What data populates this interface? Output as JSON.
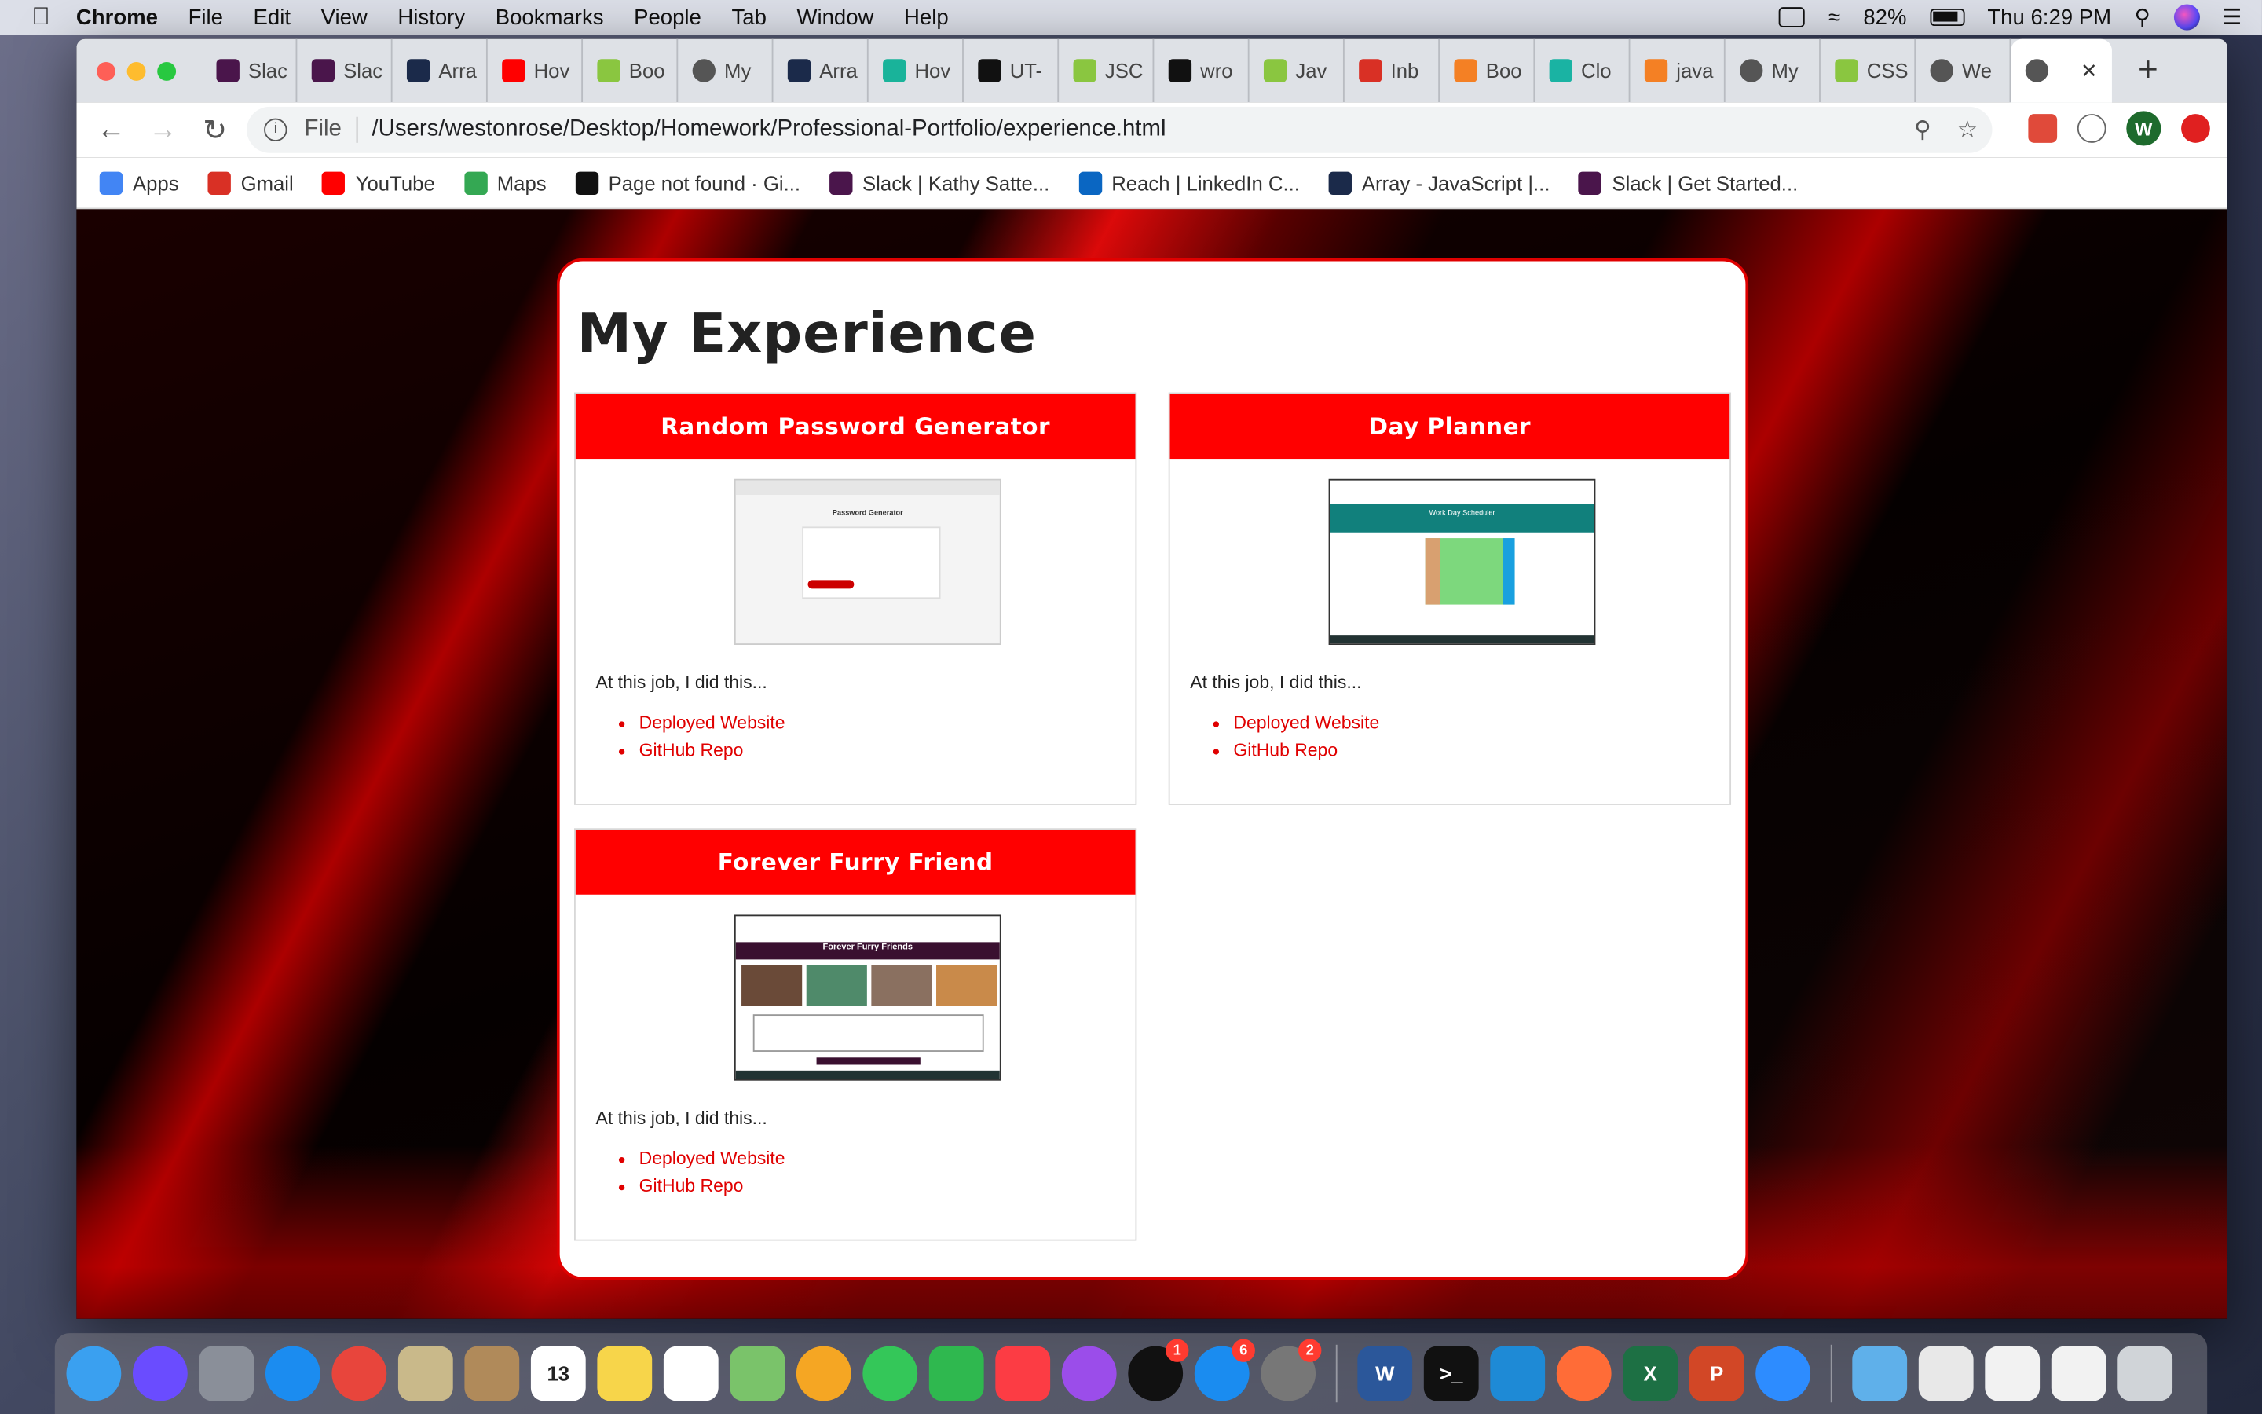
{
  "menubar": {
    "app": "Chrome",
    "items": [
      "File",
      "Edit",
      "View",
      "History",
      "Bookmarks",
      "People",
      "Tab",
      "Window",
      "Help"
    ],
    "battery": "82%",
    "clock": "Thu 6:29 PM"
  },
  "tabs": [
    {
      "label": "Slac",
      "icon": "slack-icon",
      "color": "#4a154b"
    },
    {
      "label": "Slac",
      "icon": "slack-icon",
      "color": "#4a154b"
    },
    {
      "label": "Arra",
      "icon": "mdn-icon",
      "color": "#1b2a4a"
    },
    {
      "label": "Hov",
      "icon": "youtube-icon",
      "color": "#ff0000"
    },
    {
      "label": "Boo",
      "icon": "w3schools-icon",
      "color": "#8ac640"
    },
    {
      "label": "My",
      "icon": "globe-icon",
      "color": "#555555"
    },
    {
      "label": "Arra",
      "icon": "mdn-icon",
      "color": "#1b2a4a"
    },
    {
      "label": "Hov",
      "icon": "codepen-icon",
      "color": "#19b39a"
    },
    {
      "label": "UT-",
      "icon": "github-icon",
      "color": "#111111"
    },
    {
      "label": "JSC",
      "icon": "w3schools-icon",
      "color": "#8ac640"
    },
    {
      "label": "wro",
      "icon": "github-icon",
      "color": "#111111"
    },
    {
      "label": "Jav",
      "icon": "w3schools-icon",
      "color": "#8ac640"
    },
    {
      "label": "Inb",
      "icon": "gmail-icon",
      "color": "#d93025"
    },
    {
      "label": "Boo",
      "icon": "stackoverflow-icon",
      "color": "#f48024"
    },
    {
      "label": "Clo",
      "icon": "docs-icon",
      "color": "#1ab3a3"
    },
    {
      "label": "java",
      "icon": "stackoverflow-icon",
      "color": "#f48024"
    },
    {
      "label": "My",
      "icon": "globe-icon",
      "color": "#555555"
    },
    {
      "label": "CSS",
      "icon": "w3schools-icon",
      "color": "#8ac640"
    },
    {
      "label": "We",
      "icon": "globe-icon",
      "color": "#555555"
    }
  ],
  "address": {
    "scheme": "File",
    "url": "/Users/westonrose/Desktop/Homework/Professional-Portfolio/experience.html"
  },
  "profile_initial": "W",
  "bookmarks": [
    {
      "label": "Apps",
      "icon": "apps-grid-icon",
      "color": "#4285f4"
    },
    {
      "label": "Gmail",
      "icon": "gmail-icon",
      "color": "#d93025"
    },
    {
      "label": "YouTube",
      "icon": "youtube-icon",
      "color": "#ff0000"
    },
    {
      "label": "Maps",
      "icon": "maps-icon",
      "color": "#34a853"
    },
    {
      "label": "Page not found · Gi...",
      "icon": "github-icon",
      "color": "#111111"
    },
    {
      "label": "Slack | Kathy Satte...",
      "icon": "slack-icon",
      "color": "#4a154b"
    },
    {
      "label": "Reach | LinkedIn C...",
      "icon": "linkedin-icon",
      "color": "#0a66c2"
    },
    {
      "label": "Array - JavaScript |...",
      "icon": "mdn-icon",
      "color": "#1b2a4a"
    },
    {
      "label": "Slack | Get Started...",
      "icon": "slack-icon",
      "color": "#4a154b"
    }
  ],
  "page": {
    "heading": "My Experience",
    "cards": [
      {
        "title": "Random Password Generator",
        "thumb_title": "Password Generator",
        "text": "At this job, I did this...",
        "links": [
          "Deployed Website",
          "GitHub Repo"
        ]
      },
      {
        "title": "Day Planner",
        "thumb_title": "Work Day Scheduler",
        "text": "At this job, I did this...",
        "links": [
          "Deployed Website",
          "GitHub Repo"
        ]
      },
      {
        "title": "Forever Furry Friend",
        "thumb_title": "Forever Furry Friends",
        "text": "At this job, I did this...",
        "links": [
          "Deployed Website",
          "GitHub Repo"
        ]
      }
    ]
  },
  "dock": {
    "apps": [
      {
        "name": "finder-icon",
        "color": "#3aa0f0"
      },
      {
        "name": "siri-icon",
        "color": "#6a4cff"
      },
      {
        "name": "launchpad-icon",
        "color": "#8a8f99"
      },
      {
        "name": "safari-icon",
        "color": "#1b8cf0"
      },
      {
        "name": "chrome-icon",
        "color": "#e8453c"
      },
      {
        "name": "mail-eagle-icon",
        "color": "#c9b98a"
      },
      {
        "name": "contacts-icon",
        "color": "#b08a5a"
      },
      {
        "name": "calendar-icon",
        "color": "#ffffff",
        "text": "13"
      },
      {
        "name": "notes-icon",
        "color": "#f7d54a"
      },
      {
        "name": "reminders-icon",
        "color": "#ffffff"
      },
      {
        "name": "maps-icon",
        "color": "#7ac36a"
      },
      {
        "name": "photos-icon",
        "color": "#f5a623"
      },
      {
        "name": "messages-icon",
        "color": "#34c759"
      },
      {
        "name": "facetime-icon",
        "color": "#2fb84f"
      },
      {
        "name": "music-icon",
        "color": "#fc3c44"
      },
      {
        "name": "podcasts-icon",
        "color": "#9b4dea"
      },
      {
        "name": "tv-icon",
        "color": "#111111",
        "badge": "1"
      },
      {
        "name": "app-store-icon",
        "color": "#1a8cf0",
        "badge": "6"
      },
      {
        "name": "system-preferences-icon",
        "color": "#777777",
        "badge": "2"
      },
      {
        "name": "word-icon",
        "color": "#2b579a",
        "text": "W"
      },
      {
        "name": "terminal-icon",
        "color": "#111111",
        "text": ">_"
      },
      {
        "name": "vscode-icon",
        "color": "#1e8ad6"
      },
      {
        "name": "postman-icon",
        "color": "#ff6c37"
      },
      {
        "name": "excel-icon",
        "color": "#1d7044",
        "text": "X"
      },
      {
        "name": "powerpoint-icon",
        "color": "#d24726",
        "text": "P"
      },
      {
        "name": "zoom-icon",
        "color": "#2d8cff"
      }
    ],
    "right": [
      {
        "name": "folder-icon",
        "color": "#5fb0ea"
      },
      {
        "name": "screenshot-icon",
        "color": "#e8e8e8"
      },
      {
        "name": "document-icon",
        "color": "#f2f2f2"
      },
      {
        "name": "document-icon",
        "color": "#f2f2f2"
      },
      {
        "name": "trash-icon",
        "color": "#d0d4d8"
      }
    ]
  }
}
